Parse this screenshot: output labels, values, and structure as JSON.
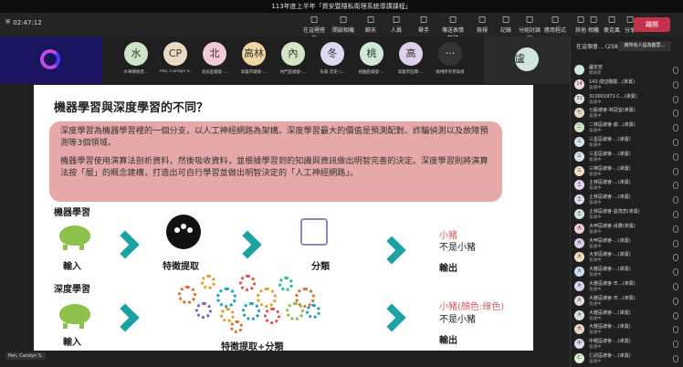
{
  "window": {
    "title": "113年度上半年「資安暨隱私衛理系統導講課程」"
  },
  "toolbar": {
    "timer": "02:47:12",
    "items": [
      {
        "label": "在這裡搭載",
        "icon": "layout-icon"
      },
      {
        "label": "開啟相機",
        "icon": "camera-icon"
      },
      {
        "label": "聊天",
        "icon": "chat-icon"
      },
      {
        "label": "人員",
        "icon": "people-icon",
        "badge": "258"
      },
      {
        "label": "舉手",
        "icon": "hand-icon"
      },
      {
        "label": "傳送表情符號",
        "icon": "emoji-icon"
      },
      {
        "label": "檢視",
        "icon": "view-icon"
      },
      {
        "label": "記錄",
        "icon": "record-icon"
      },
      {
        "label": "分組討論室",
        "icon": "rooms-icon"
      },
      {
        "label": "應用程式",
        "icon": "apps-icon"
      },
      {
        "label": "其他",
        "icon": "more-icon"
      },
      {
        "label": "相機",
        "icon": "camera-off-icon"
      },
      {
        "label": "麥克風",
        "icon": "mic-icon"
      },
      {
        "label": "分享",
        "icon": "share-icon"
      }
    ],
    "leave_label": "離開"
  },
  "participants": [
    {
      "initial": "水",
      "name": "水華網絡曾…",
      "color": "#cfe6c6"
    },
    {
      "initial": "CP",
      "name": "Pen, Carolyn S.",
      "color": "#e8dcc0"
    },
    {
      "initial": "北",
      "name": "北投區總會-…",
      "color": "#f2c9d8"
    },
    {
      "initial": "高林",
      "name": "高雄市總會-…",
      "color": "#f0d6a0"
    },
    {
      "initial": "內",
      "name": "內門區總會-…",
      "color": "#d6e4c6"
    },
    {
      "initial": "冬",
      "name": "冬森-宮史-(…",
      "color": "#e0d8f0"
    },
    {
      "initial": "桃",
      "name": "桃園區總會-…",
      "color": "#cfe8d8"
    },
    {
      "initial": "高",
      "name": "高雄市區霖-…",
      "color": "#dcd0ec"
    },
    {
      "initial": "···",
      "name": "檢視所有參與者",
      "color": "#333333"
    }
  ],
  "spotlight": {
    "initial": "盧",
    "color": "#cfe6d8"
  },
  "slide": {
    "title": "機器學習與深度學習的不同？",
    "para1": "深度學習為機器學習裡的一個分支，以人工神經網路為架構。深度學習最大的價值是預測配對、詐騙偵測以及故障預測等3個領域。",
    "para2": "機器學習使用演算法剖析資料，然後吸收資料，並根據學習到的知識與資訊做出明智完善的決定。深度學習則將演算法按「層」的概念建構，打造出可自行學習並做出明智決定的「人工神經網路」。",
    "ml_label": "機器學習",
    "dl_label": "深度學習",
    "input1": "輸入",
    "input2": "輸入",
    "feature": "特徵提取",
    "classify": "分類",
    "feature_classify": "特徵提取+分類",
    "out1_red": "小豬",
    "out1_black": "不是小豬",
    "out1_label": "輸出",
    "out2_red": "小豬(顏色:綠色)",
    "out2_black": "不是小豬",
    "out2_label": "輸出"
  },
  "presenter_name": "Pen, Carolyn S.",
  "chat": {
    "header": "在這個會… (258)",
    "button": "將所有人設為觀眾…",
    "rows": [
      {
        "initial": "",
        "name": "盧定宏",
        "sub": "簡報者",
        "color": "#cfe6d8"
      },
      {
        "initial": "14",
        "name": "143 成亞酪酸…(來賓)",
        "sub": "會議中",
        "color": "#f0d6e0"
      },
      {
        "initial": "31",
        "name": "310001971-C…(來賓)",
        "sub": "會議中",
        "color": "#e0e0e0"
      },
      {
        "initial": "七",
        "name": "七股總會-林冠宜(來賓)",
        "sub": "會議中",
        "color": "#e4dcc8"
      },
      {
        "initial": "二",
        "name": "二林區總會-謝…(來賓)",
        "sub": "會議中",
        "color": "#cfe6c6"
      },
      {
        "initial": "三",
        "name": "三星區總會-…(來賓)",
        "sub": "會議中",
        "color": "#d8e6f0"
      },
      {
        "initial": "三",
        "name": "三星區總會-…(來賓)",
        "sub": "會議中",
        "color": "#d8e6f0"
      },
      {
        "initial": "三",
        "name": "三峽區總會-…(來賓)",
        "sub": "會議中",
        "color": "#f0e0c8"
      },
      {
        "initial": "土",
        "name": "土林區總會-…(來賓)",
        "sub": "會議中",
        "color": "#e6d8f0"
      },
      {
        "initial": "土",
        "name": "土林區總會-…(來賓)",
        "sub": "會議中",
        "color": "#e6d8f0"
      },
      {
        "initial": "土",
        "name": "土林區總會-益茂蕊(來賓)",
        "sub": "會議中",
        "color": "#cfe6d8"
      },
      {
        "initial": "大",
        "name": "大甲區總會-肖豐(來賓)",
        "sub": "會議中",
        "color": "#f0d0d0"
      },
      {
        "initial": "大",
        "name": "大甲區總會-…(來賓)",
        "sub": "會議中",
        "color": "#dcd0ec"
      },
      {
        "initial": "大",
        "name": "大安區總會-…(來賓)",
        "sub": "會議中",
        "color": "#f0e0c0"
      },
      {
        "initial": "大",
        "name": "大雅區總會-…(來賓)",
        "sub": "會議中",
        "color": "#d0e0f0"
      },
      {
        "initial": "大",
        "name": "大雅區總會-辛…(來賓)",
        "sub": "會議中",
        "color": "#e0d8f0"
      },
      {
        "initial": "大",
        "name": "大雅區總會-辛…(來賓)",
        "sub": "會議中",
        "color": "#e8d8e8"
      },
      {
        "initial": "大",
        "name": "大雅區總會-…(來賓)",
        "sub": "會議中",
        "color": "#d8e8d8"
      },
      {
        "initial": "大",
        "name": "大雅區總會-…(來賓)",
        "sub": "會議中",
        "color": "#f0d8c8"
      },
      {
        "initial": "中",
        "name": "中壢區總會-…(來賓)",
        "sub": "會議中",
        "color": "#d8e0f0"
      },
      {
        "initial": "仁",
        "name": "仁武區總會-…(來賓)",
        "sub": "會議中",
        "color": "#e0f0d8"
      }
    ]
  }
}
